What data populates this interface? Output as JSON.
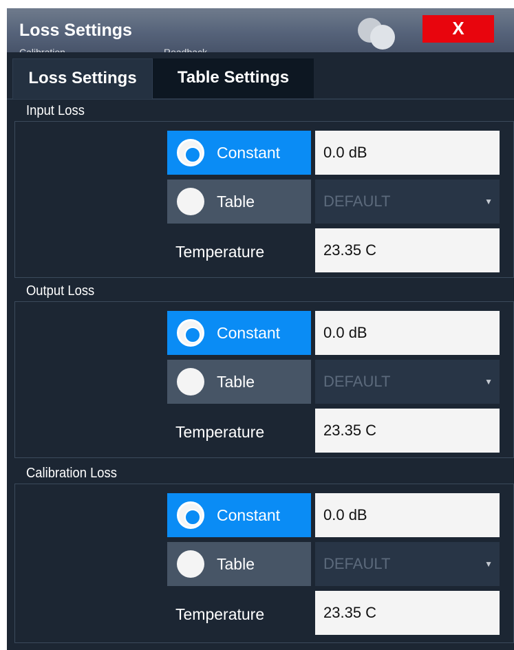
{
  "window": {
    "title": "Loss Settings",
    "close_label": "X",
    "ghost_left": "Calibration",
    "ghost_right": "Readback"
  },
  "tabs": [
    {
      "label": "Loss Settings",
      "active": true
    },
    {
      "label": "Table Settings",
      "active": false
    }
  ],
  "sections": [
    {
      "label": "Input Loss",
      "constant_label": "Constant",
      "constant_selected": true,
      "constant_value": "0.0 dB",
      "table_label": "Table",
      "table_value": "DEFAULT",
      "temperature_label": "Temperature",
      "temperature_value": "23.35 C"
    },
    {
      "label": "Output Loss",
      "constant_label": "Constant",
      "constant_selected": true,
      "constant_value": "0.0 dB",
      "table_label": "Table",
      "table_value": "DEFAULT",
      "temperature_label": "Temperature",
      "temperature_value": "23.35 C"
    },
    {
      "label": "Calibration Loss",
      "constant_label": "Constant",
      "constant_selected": true,
      "constant_value": "0.0 dB",
      "table_label": "Table",
      "table_value": "DEFAULT",
      "temperature_label": "Temperature",
      "temperature_value": "23.35 C"
    }
  ],
  "colors": {
    "accent": "#0a8cf5",
    "close": "#e8050d",
    "background": "#1c2633"
  },
  "icons": {
    "close": "close-icon",
    "dropdown": "chevron-down-icon",
    "radio_on": "radio-selected-icon",
    "radio_off": "radio-unselected-icon"
  }
}
